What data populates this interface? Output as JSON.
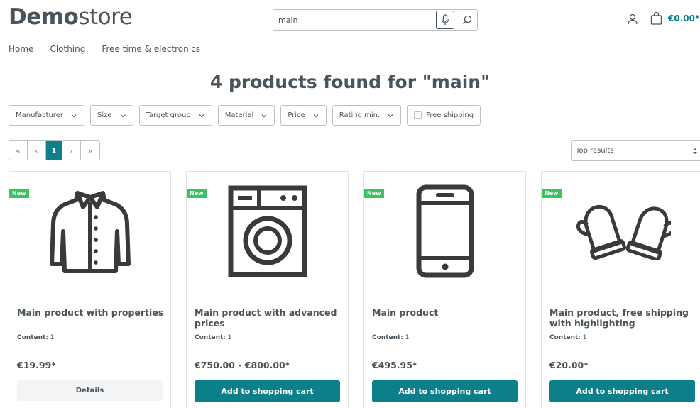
{
  "header": {
    "logo_bold": "Demo",
    "logo_light": "store",
    "search_value": "main",
    "cart_total": "€0.00*"
  },
  "nav": [
    "Home",
    "Clothing",
    "Free time & electronics"
  ],
  "title": "4 products found for \"main\"",
  "filters": [
    "Manufacturer",
    "Size",
    "Target group",
    "Material",
    "Price",
    "Rating min."
  ],
  "free_shipping": "Free shipping",
  "pagination": {
    "first": "«",
    "prev": "‹",
    "current": "1",
    "next": "›",
    "last": "»"
  },
  "sort": {
    "selected": "Top results"
  },
  "products": [
    {
      "badge": "New",
      "icon": "jacket-icon",
      "name": "Main product with properties",
      "content_label": "Content:",
      "content_value": "1",
      "price": "€19.99*",
      "button": "Details"
    },
    {
      "badge": "New",
      "icon": "washing-machine-icon",
      "name": "Main product with advanced prices",
      "content_label": "Content:",
      "content_value": "1",
      "price": "€750.00 - €800.00*",
      "button": "Add to shopping cart"
    },
    {
      "badge": "New",
      "icon": "smartphone-icon",
      "name": "Main product",
      "content_label": "Content:",
      "content_value": "1",
      "price": "€495.95*",
      "button": "Add to shopping cart"
    },
    {
      "badge": "New",
      "icon": "mittens-icon",
      "name": "Main product, free shipping with highlighting",
      "content_label": "Content:",
      "content_value": "1",
      "price": "€20.00*",
      "button": "Add to shopping cart"
    }
  ]
}
